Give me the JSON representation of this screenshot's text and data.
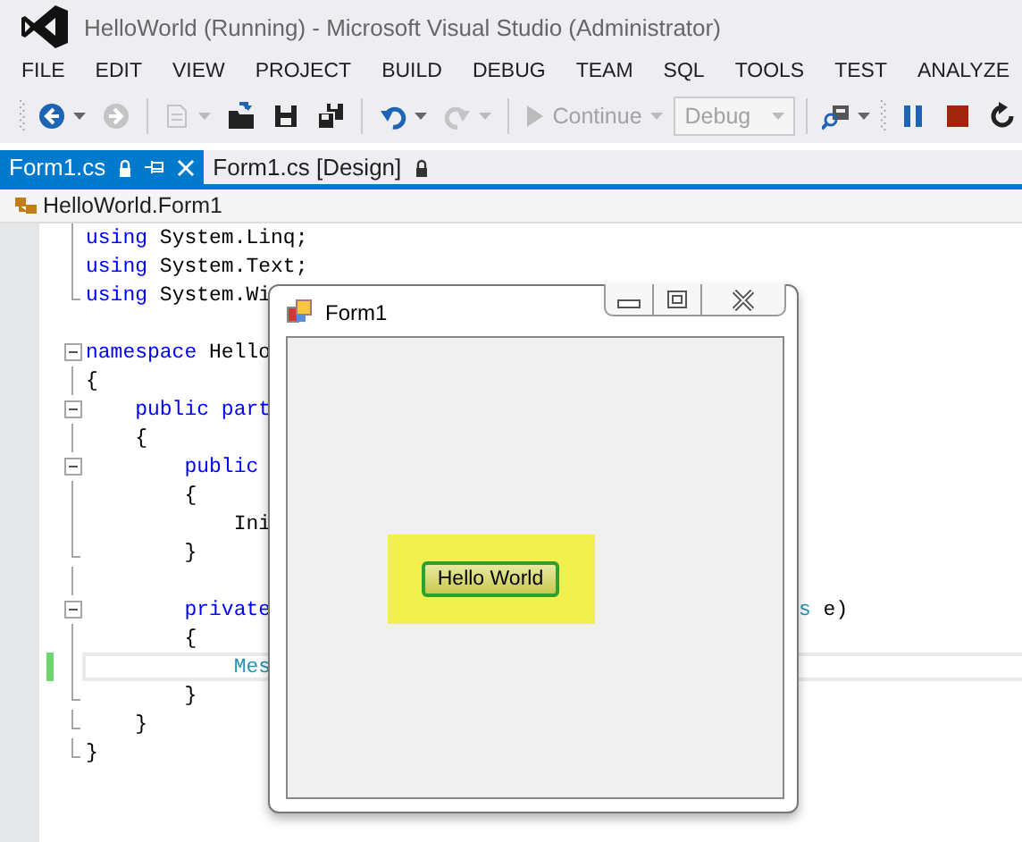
{
  "window": {
    "title": "HelloWorld (Running) - Microsoft Visual Studio (Administrator)"
  },
  "menu": [
    "FILE",
    "EDIT",
    "VIEW",
    "PROJECT",
    "BUILD",
    "DEBUG",
    "TEAM",
    "SQL",
    "TOOLS",
    "TEST",
    "ANALYZE"
  ],
  "toolbar": [
    {
      "kind": "back",
      "disabled": false,
      "dropdown": true
    },
    {
      "kind": "forward",
      "disabled": true,
      "dropdown": false
    },
    {
      "kind": "separator"
    },
    {
      "kind": "new-project",
      "disabled": true,
      "dropdown": true
    },
    {
      "kind": "open",
      "disabled": false,
      "dropdown": false
    },
    {
      "kind": "save",
      "disabled": false,
      "dropdown": false
    },
    {
      "kind": "save-all",
      "disabled": false,
      "dropdown": false
    },
    {
      "kind": "separator"
    },
    {
      "kind": "undo",
      "disabled": false,
      "dropdown": true
    },
    {
      "kind": "redo",
      "disabled": true,
      "dropdown": true
    },
    {
      "kind": "separator"
    },
    {
      "kind": "continue",
      "label": "Continue",
      "disabled": true,
      "dropdown": true
    },
    {
      "kind": "combo",
      "value": "Debug",
      "disabled": true
    },
    {
      "kind": "separator"
    },
    {
      "kind": "find",
      "disabled": false,
      "dropdown": true
    },
    {
      "kind": "grip"
    },
    {
      "kind": "pause",
      "disabled": false,
      "dropdown": false
    },
    {
      "kind": "stop",
      "disabled": false,
      "dropdown": false
    },
    {
      "kind": "restart",
      "disabled": false,
      "dropdown": false
    }
  ],
  "tabs": [
    {
      "label": "Form1.cs",
      "selected": true,
      "locked": true,
      "pin": true,
      "close": true
    },
    {
      "label": "Form1.cs [Design]",
      "selected": false,
      "locked": true,
      "pin": false,
      "close": false
    }
  ],
  "navigation": {
    "path": "HelloWorld.Form1"
  },
  "code_lines": [
    {
      "kind": "inner",
      "tokens": [
        {
          "kind": "keyword",
          "text": "using"
        },
        {
          "kind": "plain",
          "text": " System.Linq;"
        }
      ]
    },
    {
      "kind": "inner",
      "tokens": [
        {
          "kind": "keyword",
          "text": "using"
        },
        {
          "kind": "plain",
          "text": " System.Text;"
        }
      ]
    },
    {
      "kind": "end",
      "tokens": [
        {
          "kind": "keyword",
          "text": "using"
        },
        {
          "kind": "plain",
          "text": " System.Wi"
        }
      ]
    },
    {
      "kind": "blank"
    },
    {
      "kind": "start",
      "tokens": [
        {
          "kind": "keyword",
          "text": "namespace"
        },
        {
          "kind": "plain",
          "text": " Hello"
        }
      ]
    },
    {
      "kind": "inner",
      "tokens": [
        {
          "kind": "plain",
          "text": "{"
        }
      ]
    },
    {
      "kind": "start",
      "tokens": [
        {
          "kind": "keyword",
          "text": "    public part"
        }
      ]
    },
    {
      "kind": "inner",
      "tokens": [
        {
          "kind": "plain",
          "text": "    {"
        }
      ]
    },
    {
      "kind": "start",
      "tokens": [
        {
          "kind": "keyword",
          "text": "        public"
        }
      ]
    },
    {
      "kind": "inner",
      "tokens": [
        {
          "kind": "plain",
          "text": "        {"
        }
      ]
    },
    {
      "kind": "inner",
      "tokens": [
        {
          "kind": "plain",
          "text": "            Ini"
        }
      ]
    },
    {
      "kind": "end",
      "tokens": [
        {
          "kind": "plain",
          "text": "        }"
        }
      ]
    },
    {
      "kind": "inner"
    },
    {
      "kind": "start",
      "tokens": [
        {
          "kind": "keyword",
          "text": "        private"
        }
      ],
      "right": [
        {
          "kind": "type",
          "text": "s"
        },
        {
          "kind": "plain",
          "text": " e)"
        }
      ]
    },
    {
      "kind": "inner",
      "tokens": [
        {
          "kind": "plain",
          "text": "        {"
        }
      ]
    },
    {
      "kind": "inner",
      "current": true,
      "changed": true,
      "tokens": [
        {
          "kind": "type",
          "text": "            Mes"
        }
      ]
    },
    {
      "kind": "end",
      "tokens": [
        {
          "kind": "plain",
          "text": "        }"
        }
      ]
    },
    {
      "kind": "end",
      "tokens": [
        {
          "kind": "plain",
          "text": "    }"
        }
      ]
    },
    {
      "kind": "end",
      "tokens": [
        {
          "kind": "plain",
          "text": "}"
        }
      ]
    }
  ],
  "form_window": {
    "title": "Form1",
    "button": {
      "label": "Hello World"
    }
  }
}
